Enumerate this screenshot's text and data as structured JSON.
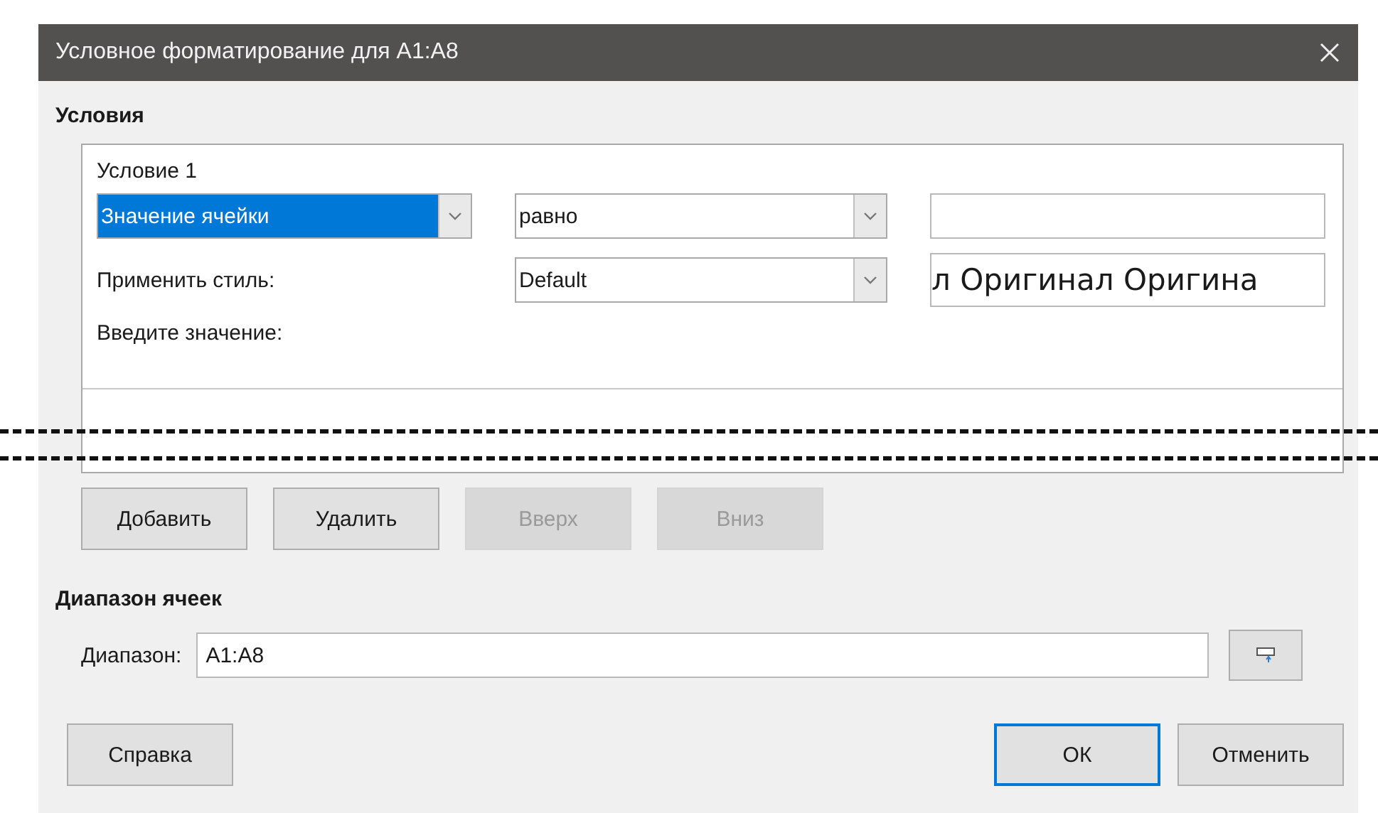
{
  "window": {
    "title": "Условное форматирование для A1:A8"
  },
  "conditions": {
    "heading": "Условия",
    "items": [
      {
        "label": "Условие 1",
        "type_select": {
          "value": "Значение ячейки",
          "highlighted": true
        },
        "operator_select": {
          "value": "равно",
          "highlighted": false
        },
        "style_label": "Применить стиль:",
        "style_select": {
          "value": "Default",
          "highlighted": false
        },
        "preview": "л Оригинал Оригина",
        "value_label": "Введите значение:"
      }
    ],
    "buttons": [
      {
        "label": "Добавить",
        "disabled": false
      },
      {
        "label": "Удалить",
        "disabled": false
      },
      {
        "label": "Вверх",
        "disabled": true
      },
      {
        "label": "Вниз",
        "disabled": true
      }
    ]
  },
  "cell_range": {
    "heading": "Диапазон ячеек",
    "label": "Диапазон:",
    "value": "A1:A8"
  },
  "footer_left": [
    {
      "label": "Справка",
      "default": false
    }
  ],
  "footer_right": [
    {
      "label": "ОК",
      "default": true
    },
    {
      "label": "Отменить",
      "default": false
    }
  ]
}
